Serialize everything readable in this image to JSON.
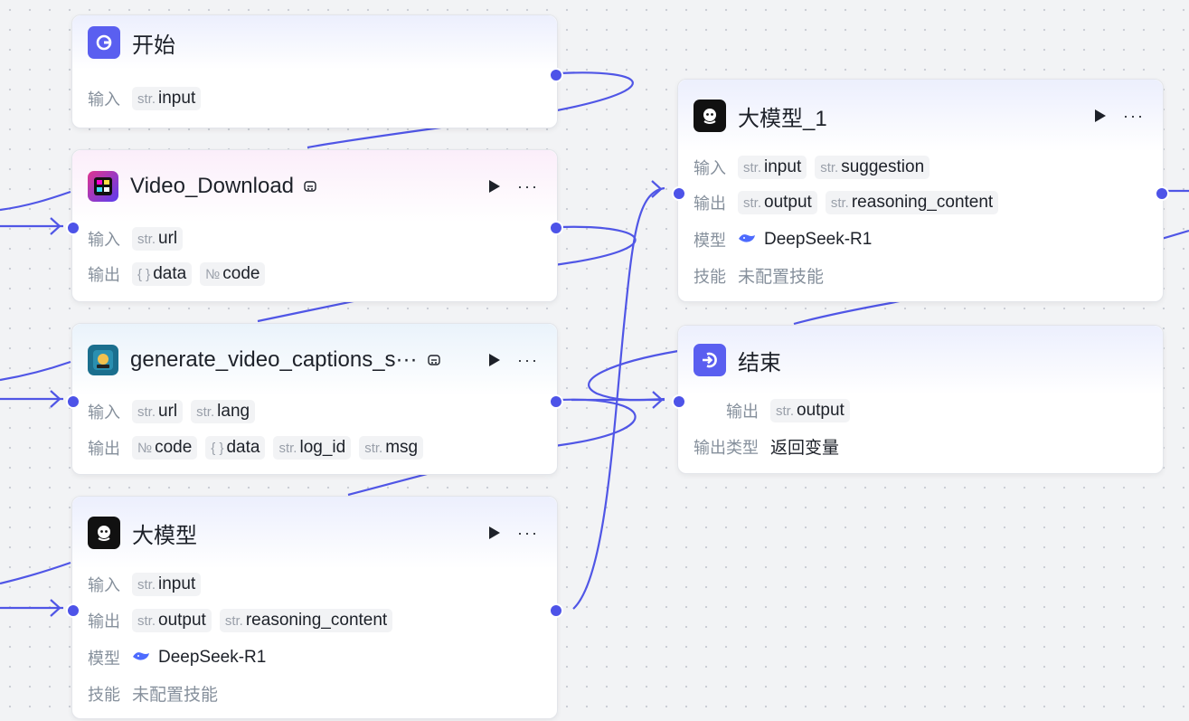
{
  "colors": {
    "accent": "#4d53e8",
    "edge": "#5056e6",
    "canvas": "#f2f3f5"
  },
  "nodes": {
    "start": {
      "icon": "start-icon",
      "title": "开始",
      "input_label": "输入",
      "inputs": [
        {
          "type": "str.",
          "name": "input"
        }
      ]
    },
    "video_download": {
      "icon": "video-download-plugin-icon",
      "title": "Video_Download",
      "input_label": "输入",
      "output_label": "输出",
      "inputs": [
        {
          "type": "str.",
          "name": "url"
        }
      ],
      "outputs": [
        {
          "type": "{ }",
          "name": "data"
        },
        {
          "type": "№",
          "name": "code"
        }
      ]
    },
    "captions": {
      "icon": "captions-plugin-icon",
      "title": "generate_video_captions_s···",
      "input_label": "输入",
      "output_label": "输出",
      "inputs": [
        {
          "type": "str.",
          "name": "url"
        },
        {
          "type": "str.",
          "name": "lang"
        }
      ],
      "outputs": [
        {
          "type": "№",
          "name": "code"
        },
        {
          "type": "{ }",
          "name": "data"
        },
        {
          "type": "str.",
          "name": "log_id"
        },
        {
          "type": "str.",
          "name": "msg"
        }
      ]
    },
    "llm": {
      "icon": "llm-icon",
      "title": "大模型",
      "input_label": "输入",
      "output_label": "输出",
      "model_label": "模型",
      "skill_label": "技能",
      "inputs": [
        {
          "type": "str.",
          "name": "input"
        }
      ],
      "outputs": [
        {
          "type": "str.",
          "name": "output"
        },
        {
          "type": "str.",
          "name": "reasoning_content"
        }
      ],
      "model": "DeepSeek-R1",
      "model_icon": "deepseek-whale-icon",
      "skill": "未配置技能"
    },
    "llm1": {
      "icon": "llm-icon",
      "title": "大模型_1",
      "input_label": "输入",
      "output_label": "输出",
      "model_label": "模型",
      "skill_label": "技能",
      "inputs": [
        {
          "type": "str.",
          "name": "input"
        },
        {
          "type": "str.",
          "name": "suggestion"
        }
      ],
      "outputs": [
        {
          "type": "str.",
          "name": "output"
        },
        {
          "type": "str.",
          "name": "reasoning_content"
        }
      ],
      "model": "DeepSeek-R1",
      "model_icon": "deepseek-whale-icon",
      "skill": "未配置技能"
    },
    "end": {
      "icon": "end-icon",
      "title": "结束",
      "output_label": "输出",
      "outputs": [
        {
          "type": "str.",
          "name": "output"
        }
      ],
      "output_type_label": "输出类型",
      "output_type": "返回变量"
    }
  }
}
